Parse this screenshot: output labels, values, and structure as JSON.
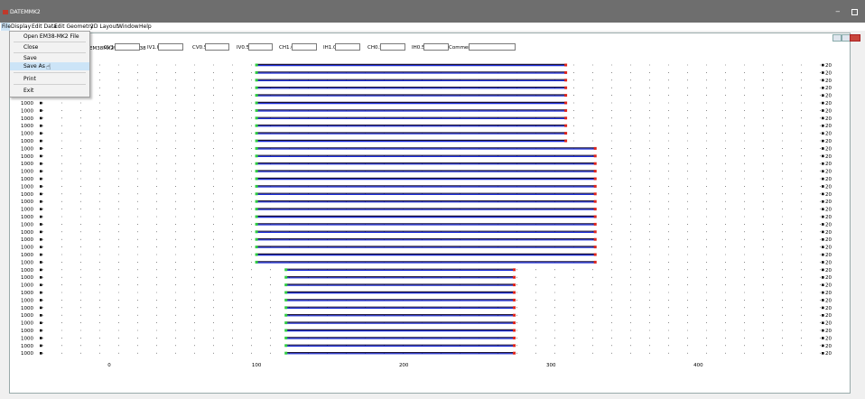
{
  "window": {
    "title": "DATEMMK2",
    "minimize_glyph": "−"
  },
  "menubar": {
    "items": [
      "File",
      "Display",
      "Edit Data",
      "Edit Geometry",
      "2D Layout",
      "Window",
      "Help"
    ]
  },
  "file_menu": {
    "items": [
      "Open EM38-MK2 File",
      "Close",
      "Save",
      "Save As",
      "Print",
      "Exit"
    ],
    "hovered": "Save As"
  },
  "document": {
    "path": "EM38MK2\\Site9-1.m38"
  },
  "params": [
    {
      "label": "CV1.0",
      "value": ""
    },
    {
      "label": "IV1.0",
      "value": ""
    },
    {
      "label": "CV0.5",
      "value": ""
    },
    {
      "label": "IV0.5",
      "value": ""
    },
    {
      "label": "CH1.0",
      "value": ""
    },
    {
      "label": "IH1.0",
      "value": ""
    },
    {
      "label": "CH0.5",
      "value": ""
    },
    {
      "label": "IH0.5",
      "value": ""
    },
    {
      "label": "Comment",
      "value": ""
    }
  ],
  "plot": {
    "left_label": "1000",
    "right_label": "20",
    "x_ticks": [
      "0",
      "100",
      "200",
      "300",
      "400"
    ],
    "colors": {
      "line_blue": "#1d2fd9",
      "line_dark": "#1a1033",
      "start_green": "#2ecc40",
      "end_red": "#e0241b",
      "axis": "#444444"
    },
    "line_groups": [
      {
        "rows": 11,
        "start": 100,
        "end": 310
      },
      {
        "rows": 16,
        "start": 100,
        "end": 330
      },
      {
        "rows": 12,
        "start": 120,
        "end": 275
      }
    ]
  }
}
